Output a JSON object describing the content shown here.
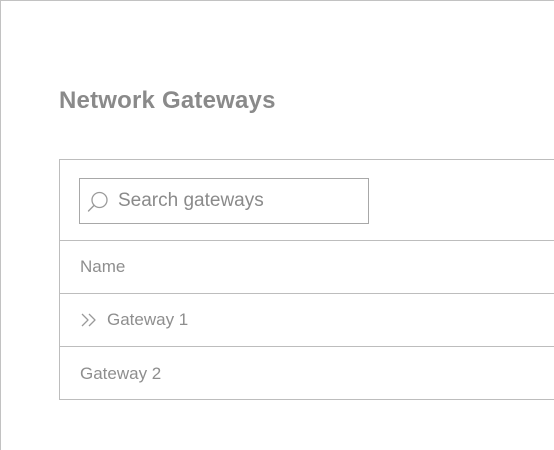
{
  "page": {
    "title": "Network Gateways"
  },
  "search": {
    "placeholder": "Search gateways",
    "value": "",
    "icon": "search-icon"
  },
  "table": {
    "columns": [
      "Name"
    ],
    "rows": [
      {
        "name": "Gateway 1",
        "expander_icon": "chevron-double-right-icon"
      },
      {
        "name": "Gateway 2"
      }
    ]
  },
  "colors": {
    "text": "#8a8a8a",
    "border": "#bdbdbd"
  }
}
